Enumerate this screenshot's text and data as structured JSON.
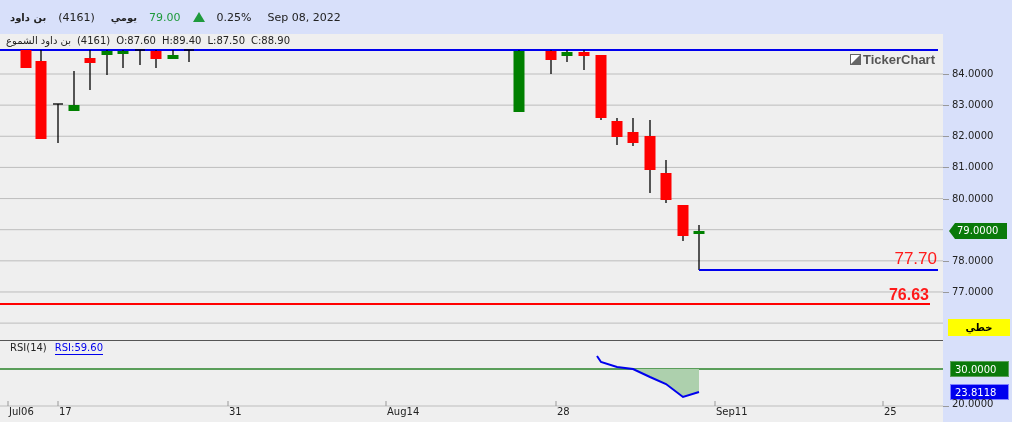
{
  "header": {
    "name": "بن داود",
    "code": "(4161)",
    "period": "يومي",
    "price": "79.00",
    "rising": true,
    "change": "0.25%",
    "date": "Sep 08, 2022"
  },
  "info_line": {
    "label": "بن داود الشموع",
    "code": "(4161)",
    "open": "O:87.60",
    "high": "H:89.40",
    "low": "L:87.50",
    "close": "C:88.90"
  },
  "logo": "TickerChart",
  "price_axis": {
    "ticks": [
      "84.0000",
      "83.0000",
      "82.0000",
      "81.0000",
      "80.0000",
      "78.0000",
      "77.0000"
    ],
    "last_price": "79.0000",
    "line_type": "خطي"
  },
  "levels": [
    {
      "label": "77.70",
      "kind": "thin"
    },
    {
      "label": "76.63",
      "kind": "bold"
    }
  ],
  "rsi": {
    "title": "RSI(14)",
    "value": "RSI:59.60",
    "axis": [
      {
        "label": "30.0000",
        "kind": "threshold"
      },
      {
        "label": "23.8118",
        "kind": "current"
      },
      {
        "label": "20.0000",
        "kind": "plain"
      }
    ]
  },
  "time_axis": [
    "Jul06",
    "17",
    "31",
    "Aug14",
    "28",
    "Sep11",
    "25"
  ]
}
